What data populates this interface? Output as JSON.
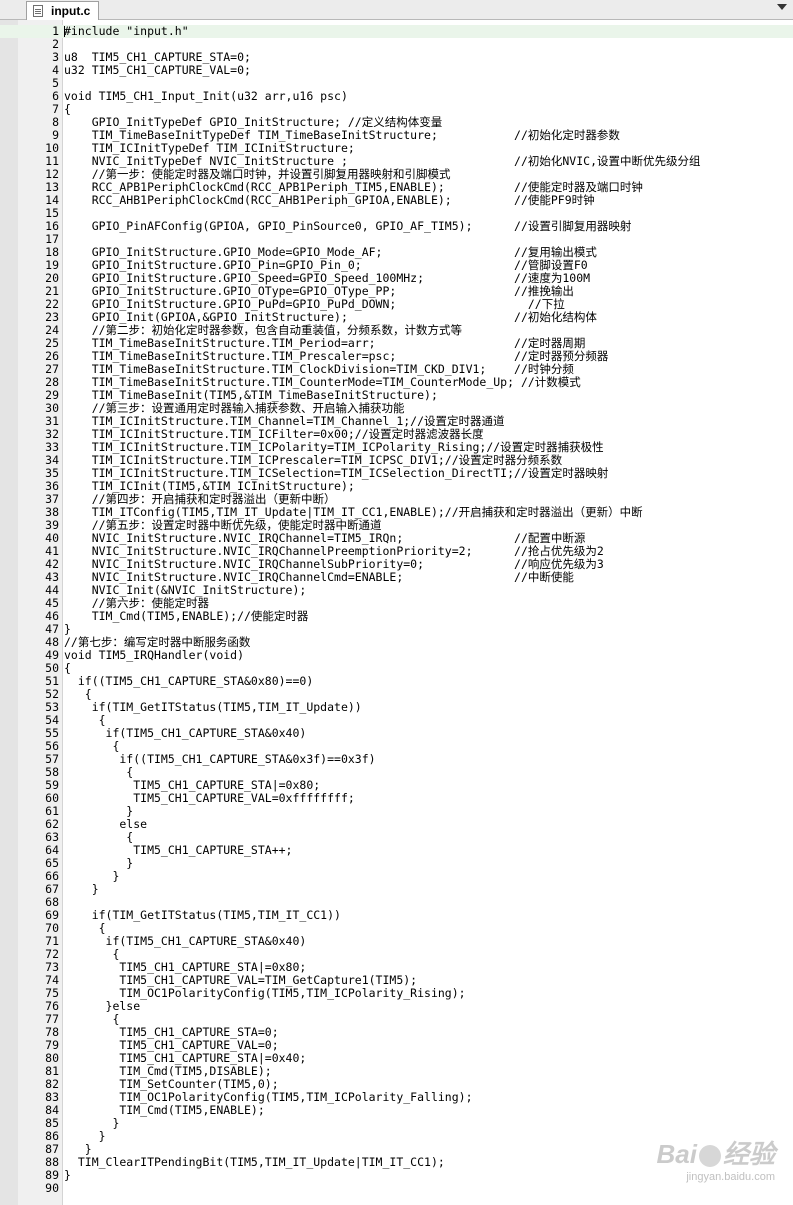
{
  "tab": {
    "title": "input.c"
  },
  "watermark": {
    "brand": "Bai",
    "brand2": "经验",
    "url": "jingyan.baidu.com"
  },
  "lines": [
    {
      "n": "1",
      "t": "#include \"input.h\""
    },
    {
      "n": "2",
      "t": ""
    },
    {
      "n": "3",
      "t": "u8  TIM5_CH1_CAPTURE_STA=0;"
    },
    {
      "n": "4",
      "t": "u32 TIM5_CH1_CAPTURE_VAL=0;"
    },
    {
      "n": "5",
      "t": ""
    },
    {
      "n": "6",
      "t": "void TIM5_CH1_Input_Init(u32 arr,u16 psc)"
    },
    {
      "n": "7",
      "t": "{"
    },
    {
      "n": "8",
      "t": "    GPIO_InitTypeDef GPIO_InitStructure; //定义结构体变量"
    },
    {
      "n": "9",
      "t": "    TIM_TimeBaseInitTypeDef TIM_TimeBaseInitStructure;           //初始化定时器参数"
    },
    {
      "n": "10",
      "t": "    TIM_ICInitTypeDef TIM_ICInitStructure;"
    },
    {
      "n": "11",
      "t": "    NVIC_InitTypeDef NVIC_InitStructure ;                        //初始化NVIC,设置中断优先级分组"
    },
    {
      "n": "12",
      "t": "    //第一步：使能定时器及端口时钟，并设置引脚复用器映射和引脚模式"
    },
    {
      "n": "13",
      "t": "    RCC_APB1PeriphClockCmd(RCC_APB1Periph_TIM5,ENABLE);          //使能定时器及端口时钟"
    },
    {
      "n": "14",
      "t": "    RCC_AHB1PeriphClockCmd(RCC_AHB1Periph_GPIOA,ENABLE);         //使能PF9时钟"
    },
    {
      "n": "15",
      "t": ""
    },
    {
      "n": "16",
      "t": "    GPIO_PinAFConfig(GPIOA, GPIO_PinSource0, GPIO_AF_TIM5);      //设置引脚复用器映射"
    },
    {
      "n": "17",
      "t": ""
    },
    {
      "n": "18",
      "t": "    GPIO_InitStructure.GPIO_Mode=GPIO_Mode_AF;                   //复用输出模式"
    },
    {
      "n": "19",
      "t": "    GPIO_InitStructure.GPIO_Pin=GPIO_Pin_0;                      //管脚设置F0"
    },
    {
      "n": "20",
      "t": "    GPIO_InitStructure.GPIO_Speed=GPIO_Speed_100MHz;             //速度为100M"
    },
    {
      "n": "21",
      "t": "    GPIO_InitStructure.GPIO_OType=GPIO_OType_PP;                 //推挽输出"
    },
    {
      "n": "22",
      "t": "    GPIO_InitStructure.GPIO_PuPd=GPIO_PuPd_DOWN;                   //下拉"
    },
    {
      "n": "23",
      "t": "    GPIO_Init(GPIOA,&GPIO_InitStructure);                        //初始化结构体"
    },
    {
      "n": "24",
      "t": "    //第二步：初始化定时器参数，包含自动重装值，分频系数，计数方式等"
    },
    {
      "n": "25",
      "t": "    TIM_TimeBaseInitStructure.TIM_Period=arr;                    //定时器周期"
    },
    {
      "n": "26",
      "t": "    TIM_TimeBaseInitStructure.TIM_Prescaler=psc;                 //定时器预分频器"
    },
    {
      "n": "27",
      "t": "    TIM_TimeBaseInitStructure.TIM_ClockDivision=TIM_CKD_DIV1;    //时钟分频"
    },
    {
      "n": "28",
      "t": "    TIM_TimeBaseInitStructure.TIM_CounterMode=TIM_CounterMode_Up; //计数模式"
    },
    {
      "n": "29",
      "t": "    TIM_TimeBaseInit(TIM5,&TIM_TimeBaseInitStructure);"
    },
    {
      "n": "30",
      "t": "    //第三步：设置通用定时器输入捕获参数、开启输入捕获功能"
    },
    {
      "n": "31",
      "t": "    TIM_ICInitStructure.TIM_Channel=TIM_Channel_1;//设置定时器通道"
    },
    {
      "n": "32",
      "t": "    TIM_ICInitStructure.TIM_ICFilter=0x00;//设置定时器滤波器长度"
    },
    {
      "n": "33",
      "t": "    TIM_ICInitStructure.TIM_ICPolarity=TIM_ICPolarity_Rising;//设置定时器捕获极性"
    },
    {
      "n": "34",
      "t": "    TIM_ICInitStructure.TIM_ICPrescaler=TIM_ICPSC_DIV1;//设置定时器分频系数"
    },
    {
      "n": "35",
      "t": "    TIM_ICInitStructure.TIM_ICSelection=TIM_ICSelection_DirectTI;//设置定时器映射"
    },
    {
      "n": "36",
      "t": "    TIM_ICInit(TIM5,&TIM_ICInitStructure);"
    },
    {
      "n": "37",
      "t": "    //第四步：开启捕获和定时器溢出（更新中断）"
    },
    {
      "n": "38",
      "t": "    TIM_ITConfig(TIM5,TIM_IT_Update|TIM_IT_CC1,ENABLE);//开启捕获和定时器溢出（更新）中断"
    },
    {
      "n": "39",
      "t": "    //第五步：设置定时器中断优先级，使能定时器中断通道"
    },
    {
      "n": "40",
      "t": "    NVIC_InitStructure.NVIC_IRQChannel=TIM5_IRQn;                //配置中断源"
    },
    {
      "n": "41",
      "t": "    NVIC_InitStructure.NVIC_IRQChannelPreemptionPriority=2;      //抢占优先级为2"
    },
    {
      "n": "42",
      "t": "    NVIC_InitStructure.NVIC_IRQChannelSubPriority=0;             //响应优先级为3"
    },
    {
      "n": "43",
      "t": "    NVIC_InitStructure.NVIC_IRQChannelCmd=ENABLE;                //中断使能"
    },
    {
      "n": "44",
      "t": "    NVIC_Init(&NVIC_InitStructure);"
    },
    {
      "n": "45",
      "t": "    //第六步：使能定时器"
    },
    {
      "n": "46",
      "t": "    TIM_Cmd(TIM5,ENABLE);//使能定时器"
    },
    {
      "n": "47",
      "t": "}"
    },
    {
      "n": "48",
      "t": "//第七步：编写定时器中断服务函数"
    },
    {
      "n": "49",
      "t": "void TIM5_IRQHandler(void)"
    },
    {
      "n": "50",
      "t": "{"
    },
    {
      "n": "51",
      "t": "  if((TIM5_CH1_CAPTURE_STA&0x80)==0)"
    },
    {
      "n": "52",
      "t": "   {"
    },
    {
      "n": "53",
      "t": "    if(TIM_GetITStatus(TIM5,TIM_IT_Update))"
    },
    {
      "n": "54",
      "t": "     {"
    },
    {
      "n": "55",
      "t": "      if(TIM5_CH1_CAPTURE_STA&0x40)"
    },
    {
      "n": "56",
      "t": "       {"
    },
    {
      "n": "57",
      "t": "        if((TIM5_CH1_CAPTURE_STA&0x3f)==0x3f)"
    },
    {
      "n": "58",
      "t": "         {"
    },
    {
      "n": "59",
      "t": "          TIM5_CH1_CAPTURE_STA|=0x80;"
    },
    {
      "n": "60",
      "t": "          TIM5_CH1_CAPTURE_VAL=0xffffffff;"
    },
    {
      "n": "61",
      "t": "         }"
    },
    {
      "n": "62",
      "t": "        else"
    },
    {
      "n": "63",
      "t": "         {"
    },
    {
      "n": "64",
      "t": "          TIM5_CH1_CAPTURE_STA++;"
    },
    {
      "n": "65",
      "t": "         }"
    },
    {
      "n": "66",
      "t": "       }"
    },
    {
      "n": "67",
      "t": "    }"
    },
    {
      "n": "68",
      "t": ""
    },
    {
      "n": "69",
      "t": "    if(TIM_GetITStatus(TIM5,TIM_IT_CC1))"
    },
    {
      "n": "70",
      "t": "     {"
    },
    {
      "n": "71",
      "t": "      if(TIM5_CH1_CAPTURE_STA&0x40)"
    },
    {
      "n": "72",
      "t": "       {"
    },
    {
      "n": "73",
      "t": "        TIM5_CH1_CAPTURE_STA|=0x80;"
    },
    {
      "n": "74",
      "t": "        TIM5_CH1_CAPTURE_VAL=TIM_GetCapture1(TIM5);"
    },
    {
      "n": "75",
      "t": "        TIM_OC1PolarityConfig(TIM5,TIM_ICPolarity_Rising);"
    },
    {
      "n": "76",
      "t": "      }else"
    },
    {
      "n": "77",
      "t": "       {"
    },
    {
      "n": "78",
      "t": "        TIM5_CH1_CAPTURE_STA=0;"
    },
    {
      "n": "79",
      "t": "        TIM5_CH1_CAPTURE_VAL=0;"
    },
    {
      "n": "80",
      "t": "        TIM5_CH1_CAPTURE_STA|=0x40;"
    },
    {
      "n": "81",
      "t": "        TIM_Cmd(TIM5,DISABLE);"
    },
    {
      "n": "82",
      "t": "        TIM_SetCounter(TIM5,0);"
    },
    {
      "n": "83",
      "t": "        TIM_OC1PolarityConfig(TIM5,TIM_ICPolarity_Falling);"
    },
    {
      "n": "84",
      "t": "        TIM_Cmd(TIM5,ENABLE);"
    },
    {
      "n": "85",
      "t": "       }"
    },
    {
      "n": "86",
      "t": "     }"
    },
    {
      "n": "87",
      "t": "   }"
    },
    {
      "n": "88",
      "t": "  TIM_ClearITPendingBit(TIM5,TIM_IT_Update|TIM_IT_CC1);"
    },
    {
      "n": "89",
      "t": "}"
    },
    {
      "n": "90",
      "t": ""
    }
  ]
}
